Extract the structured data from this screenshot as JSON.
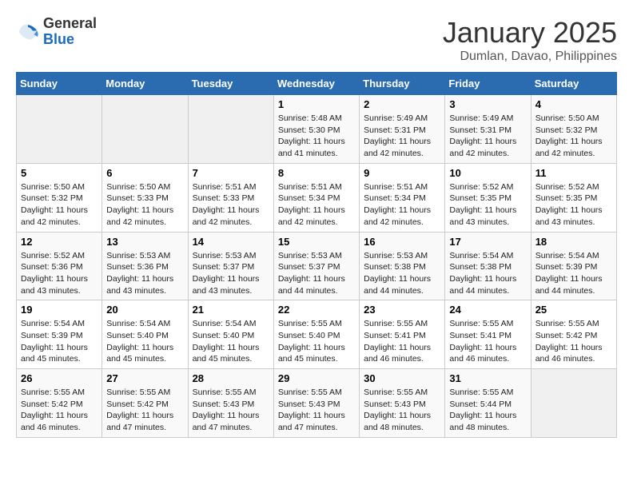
{
  "header": {
    "logo_line1": "General",
    "logo_line2": "Blue",
    "month": "January 2025",
    "location": "Dumlan, Davao, Philippines"
  },
  "weekdays": [
    "Sunday",
    "Monday",
    "Tuesday",
    "Wednesday",
    "Thursday",
    "Friday",
    "Saturday"
  ],
  "weeks": [
    [
      {
        "day": "",
        "empty": true
      },
      {
        "day": "",
        "empty": true
      },
      {
        "day": "",
        "empty": true
      },
      {
        "day": "1",
        "sunrise": "5:48 AM",
        "sunset": "5:30 PM",
        "daylight": "11 hours and 41 minutes."
      },
      {
        "day": "2",
        "sunrise": "5:49 AM",
        "sunset": "5:31 PM",
        "daylight": "11 hours and 42 minutes."
      },
      {
        "day": "3",
        "sunrise": "5:49 AM",
        "sunset": "5:31 PM",
        "daylight": "11 hours and 42 minutes."
      },
      {
        "day": "4",
        "sunrise": "5:50 AM",
        "sunset": "5:32 PM",
        "daylight": "11 hours and 42 minutes."
      }
    ],
    [
      {
        "day": "5",
        "sunrise": "5:50 AM",
        "sunset": "5:32 PM",
        "daylight": "11 hours and 42 minutes."
      },
      {
        "day": "6",
        "sunrise": "5:50 AM",
        "sunset": "5:33 PM",
        "daylight": "11 hours and 42 minutes."
      },
      {
        "day": "7",
        "sunrise": "5:51 AM",
        "sunset": "5:33 PM",
        "daylight": "11 hours and 42 minutes."
      },
      {
        "day": "8",
        "sunrise": "5:51 AM",
        "sunset": "5:34 PM",
        "daylight": "11 hours and 42 minutes."
      },
      {
        "day": "9",
        "sunrise": "5:51 AM",
        "sunset": "5:34 PM",
        "daylight": "11 hours and 42 minutes."
      },
      {
        "day": "10",
        "sunrise": "5:52 AM",
        "sunset": "5:35 PM",
        "daylight": "11 hours and 43 minutes."
      },
      {
        "day": "11",
        "sunrise": "5:52 AM",
        "sunset": "5:35 PM",
        "daylight": "11 hours and 43 minutes."
      }
    ],
    [
      {
        "day": "12",
        "sunrise": "5:52 AM",
        "sunset": "5:36 PM",
        "daylight": "11 hours and 43 minutes."
      },
      {
        "day": "13",
        "sunrise": "5:53 AM",
        "sunset": "5:36 PM",
        "daylight": "11 hours and 43 minutes."
      },
      {
        "day": "14",
        "sunrise": "5:53 AM",
        "sunset": "5:37 PM",
        "daylight": "11 hours and 43 minutes."
      },
      {
        "day": "15",
        "sunrise": "5:53 AM",
        "sunset": "5:37 PM",
        "daylight": "11 hours and 44 minutes."
      },
      {
        "day": "16",
        "sunrise": "5:53 AM",
        "sunset": "5:38 PM",
        "daylight": "11 hours and 44 minutes."
      },
      {
        "day": "17",
        "sunrise": "5:54 AM",
        "sunset": "5:38 PM",
        "daylight": "11 hours and 44 minutes."
      },
      {
        "day": "18",
        "sunrise": "5:54 AM",
        "sunset": "5:39 PM",
        "daylight": "11 hours and 44 minutes."
      }
    ],
    [
      {
        "day": "19",
        "sunrise": "5:54 AM",
        "sunset": "5:39 PM",
        "daylight": "11 hours and 45 minutes."
      },
      {
        "day": "20",
        "sunrise": "5:54 AM",
        "sunset": "5:40 PM",
        "daylight": "11 hours and 45 minutes."
      },
      {
        "day": "21",
        "sunrise": "5:54 AM",
        "sunset": "5:40 PM",
        "daylight": "11 hours and 45 minutes."
      },
      {
        "day": "22",
        "sunrise": "5:55 AM",
        "sunset": "5:40 PM",
        "daylight": "11 hours and 45 minutes."
      },
      {
        "day": "23",
        "sunrise": "5:55 AM",
        "sunset": "5:41 PM",
        "daylight": "11 hours and 46 minutes."
      },
      {
        "day": "24",
        "sunrise": "5:55 AM",
        "sunset": "5:41 PM",
        "daylight": "11 hours and 46 minutes."
      },
      {
        "day": "25",
        "sunrise": "5:55 AM",
        "sunset": "5:42 PM",
        "daylight": "11 hours and 46 minutes."
      }
    ],
    [
      {
        "day": "26",
        "sunrise": "5:55 AM",
        "sunset": "5:42 PM",
        "daylight": "11 hours and 46 minutes."
      },
      {
        "day": "27",
        "sunrise": "5:55 AM",
        "sunset": "5:42 PM",
        "daylight": "11 hours and 47 minutes."
      },
      {
        "day": "28",
        "sunrise": "5:55 AM",
        "sunset": "5:43 PM",
        "daylight": "11 hours and 47 minutes."
      },
      {
        "day": "29",
        "sunrise": "5:55 AM",
        "sunset": "5:43 PM",
        "daylight": "11 hours and 47 minutes."
      },
      {
        "day": "30",
        "sunrise": "5:55 AM",
        "sunset": "5:43 PM",
        "daylight": "11 hours and 48 minutes."
      },
      {
        "day": "31",
        "sunrise": "5:55 AM",
        "sunset": "5:44 PM",
        "daylight": "11 hours and 48 minutes."
      },
      {
        "day": "",
        "empty": true
      }
    ]
  ]
}
